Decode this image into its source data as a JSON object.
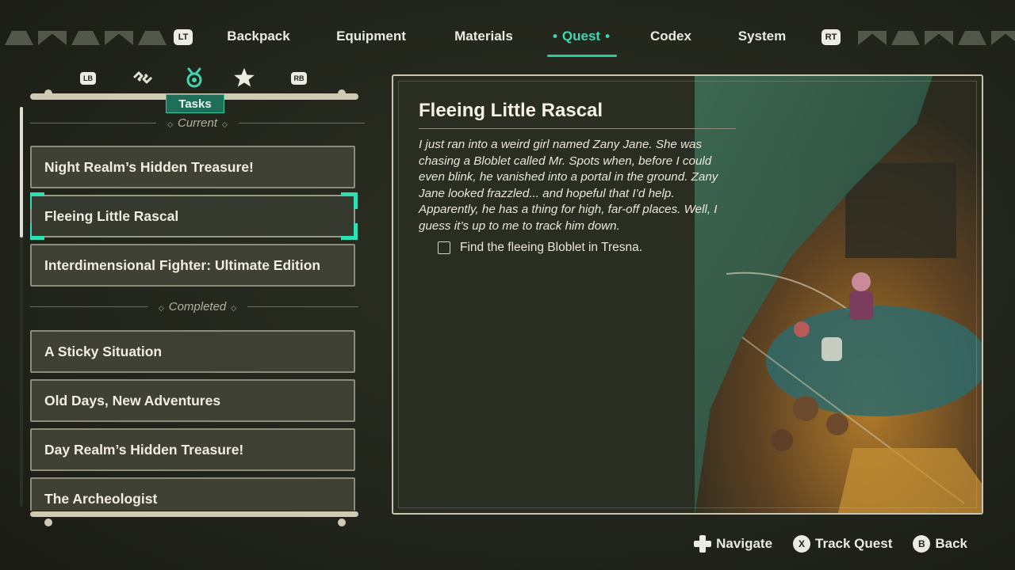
{
  "nav": {
    "left_trigger": "LT",
    "right_trigger": "RT",
    "tabs": [
      {
        "label": "Backpack"
      },
      {
        "label": "Equipment"
      },
      {
        "label": "Materials"
      },
      {
        "label": "Quest"
      },
      {
        "label": "Codex"
      },
      {
        "label": "System"
      }
    ],
    "active_tab": "Quest"
  },
  "subtabs": {
    "left_bumper": "LB",
    "right_bumper": "RB",
    "icons": [
      "link-icon",
      "tasks-icon",
      "star-icon"
    ],
    "active_label": "Tasks"
  },
  "quests": {
    "current_header": "Current",
    "completed_header": "Completed",
    "current": [
      {
        "title": "Night Realm’s Hidden Treasure!"
      },
      {
        "title": "Fleeing Little Rascal"
      },
      {
        "title": "Interdimensional Fighter: Ultimate Edition"
      }
    ],
    "completed": [
      {
        "title": "A Sticky Situation"
      },
      {
        "title": "Old Days, New Adventures"
      },
      {
        "title": "Day Realm’s Hidden Treasure!"
      },
      {
        "title": "The Archeologist"
      }
    ],
    "selected": "Fleeing Little Rascal"
  },
  "detail": {
    "title": "Fleeing Little Rascal",
    "description": "I just ran into a weird girl named Zany Jane. She was chasing a Bloblet called Mr. Spots when, before I could even blink, he vanished into a portal in the ground. Zany Jane looked frazzled... and hopeful that I’d help. Apparently, he has a thing for high, far-off places. Well, I guess it’s up to me to track him down.",
    "objectives": [
      {
        "text": "Find the fleeing Bloblet in Tresna.",
        "done": false
      }
    ]
  },
  "hints": [
    {
      "button": "dpad-icon",
      "label": "Navigate"
    },
    {
      "button": "X",
      "label": "Track Quest"
    },
    {
      "button": "B",
      "label": "Back"
    }
  ],
  "colors": {
    "accent": "#2fc9a2",
    "background": "#23261c",
    "item_bg": "#3f4134",
    "item_border": "#8d8c7b"
  }
}
